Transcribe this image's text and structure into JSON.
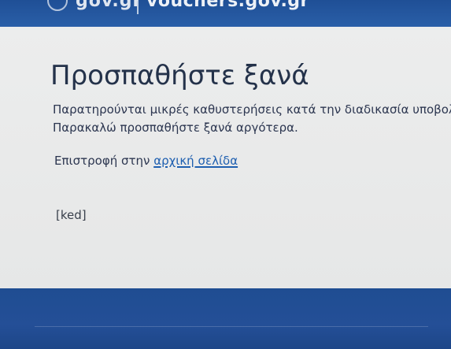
{
  "header": {
    "brand": "gov.gr",
    "site": "vouchers.gov.gr"
  },
  "error": {
    "title": "Προσπαθήστε ξανά",
    "message_line1": "Παρατηρούνται μικρές καθυστερήσεις κατά την διαδικασία υποβολή",
    "message_line2": "Παρακαλώ προσπαθήστε ξανά αργότερα.",
    "return_prefix": "Επιστροφή στην ",
    "return_link": "αρχική σελίδα",
    "code": "[ked]"
  },
  "colors": {
    "header_bg": "#2a5fa8",
    "footer_bg": "#244f97",
    "page_bg": "#e9eaea",
    "title_text": "#24324a",
    "link": "#1e5fb0"
  }
}
